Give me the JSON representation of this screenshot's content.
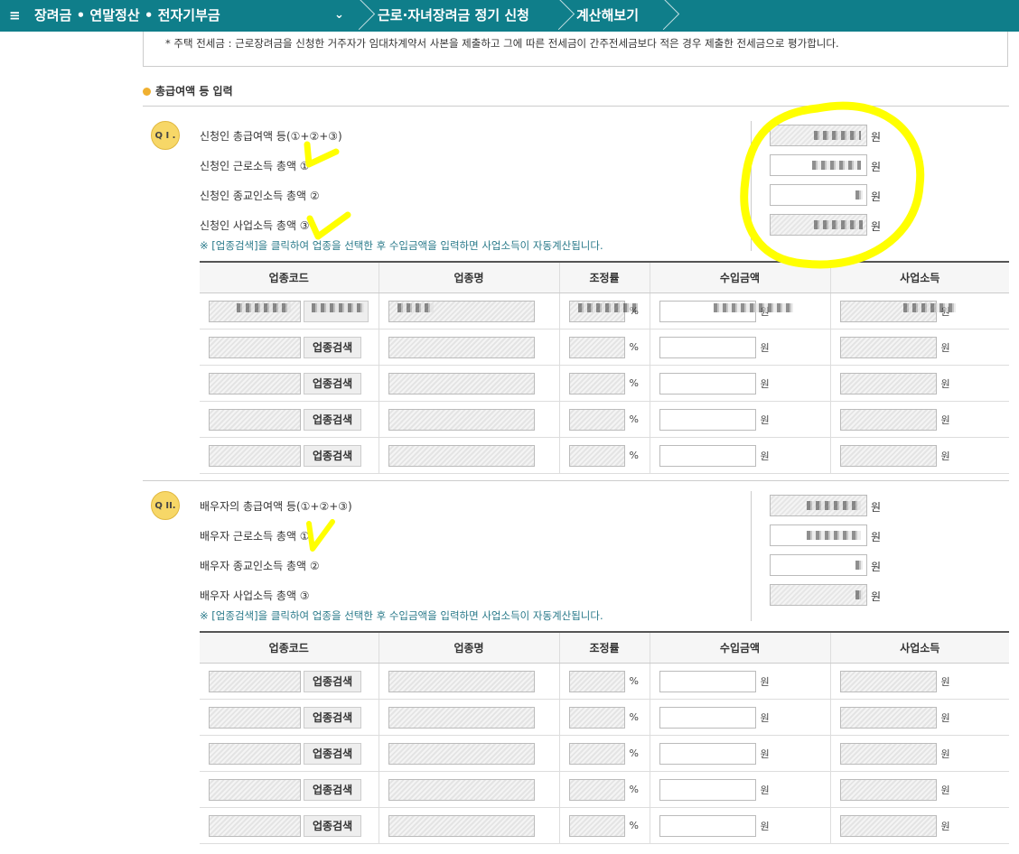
{
  "nav": {
    "menu_title": "장려금 • 연말정산 • 전자기부금",
    "crumb1": "근로·자녀장려금 정기 신청",
    "crumb2": "계산해보기"
  },
  "note": "* 주택 전세금 : 근로장려금을 신청한 거주자가 임대차계약서 사본을 제출하고 그에 따른 전세금이 간주전세금보다 적은 경우 제출한 전세금으로 평가합니다.",
  "section_title": "총급여액 등 입력",
  "q1": {
    "badge": "Q I .",
    "labels": [
      "신청인 총급여액 등(①+②+③)",
      "신청인 근로소득 총액 ①",
      "신청인 종교인소득 총액 ②",
      "신청인 사업소득 총액 ③"
    ],
    "guide": "※ [업종검색]을 클릭하여 업종을 선택한 후 수입금액을 입력하면 사업소득이 자동계산됩니다."
  },
  "q2": {
    "badge": "Q II.",
    "labels": [
      "배우자의 총급여액 등(①+②+③)",
      "배우자 근로소득 총액 ①",
      "배우자 종교인소득 총액 ②",
      "배우자 사업소득 총액 ③"
    ],
    "guide": "※ [업종검색]을 클릭하여 업종을 선택한 후 수입금액을 입력하면 사업소득이 자동계산됩니다."
  },
  "table": {
    "headers": [
      "업종코드",
      "업종명",
      "조정률",
      "수입금액",
      "사업소득"
    ],
    "search_button": "업종검색",
    "pct": "%",
    "won": "원"
  },
  "colors": {
    "topbar": "#0f7e8a",
    "highlight": "#ffff00",
    "badge": "#f7d767"
  }
}
